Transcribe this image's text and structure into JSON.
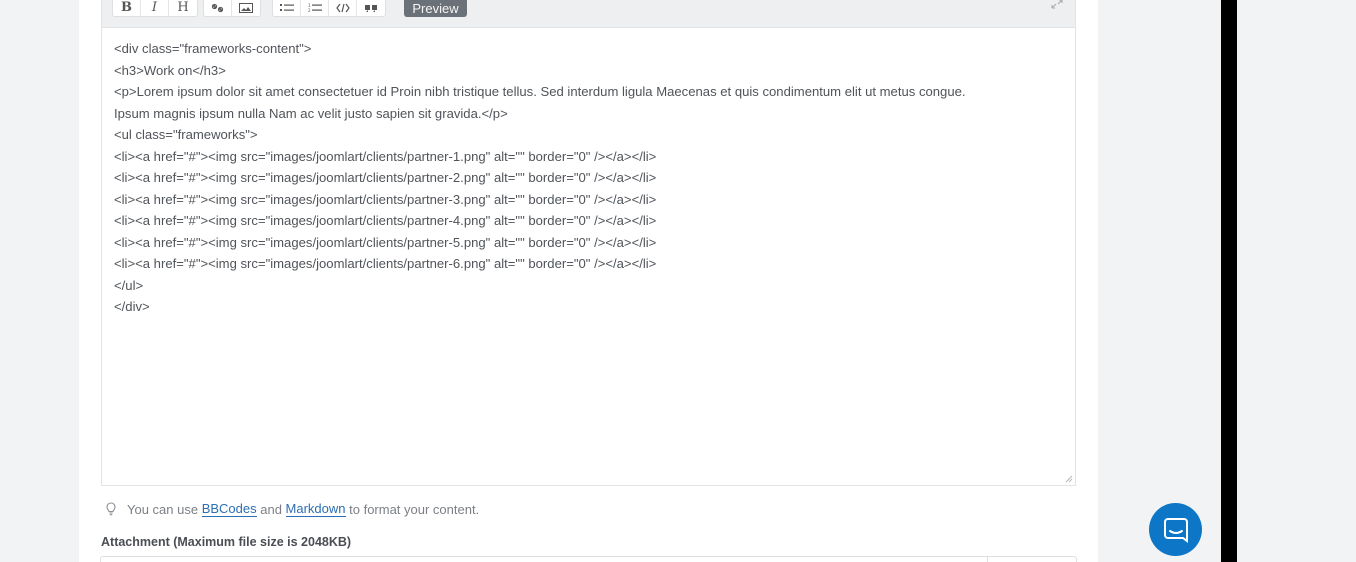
{
  "toolbar": {
    "buttons": [
      {
        "name": "bold",
        "glyph": "B"
      },
      {
        "name": "italic",
        "glyph": "I"
      },
      {
        "name": "heading",
        "glyph": "H"
      }
    ],
    "preview_label": "Preview"
  },
  "editor": {
    "lines": [
      "<div class=\"frameworks-content\">",
      "<h3>Work on</h3>",
      "<p>Lorem ipsum dolor sit amet consectetuer id Proin nibh tristique tellus. Sed interdum ligula Maecenas et quis condimentum elit ut metus congue.",
      "Ipsum magnis ipsum nulla Nam ac velit justo sapien sit gravida.</p>",
      "<ul class=\"frameworks\">",
      "<li><a href=\"#\"><img src=\"images/joomlart/clients/partner-1.png\" alt=\"\" border=\"0\" /></a></li>",
      "<li><a href=\"#\"><img src=\"images/joomlart/clients/partner-2.png\" alt=\"\" border=\"0\" /></a></li>",
      "<li><a href=\"#\"><img src=\"images/joomlart/clients/partner-3.png\" alt=\"\" border=\"0\" /></a></li>",
      "<li><a href=\"#\"><img src=\"images/joomlart/clients/partner-4.png\" alt=\"\" border=\"0\" /></a></li>",
      "<li><a href=\"#\"><img src=\"images/joomlart/clients/partner-5.png\" alt=\"\" border=\"0\" /></a></li>",
      "<li><a href=\"#\"><img src=\"images/joomlart/clients/partner-6.png\" alt=\"\" border=\"0\" /></a></li>",
      "</ul>",
      "</div>"
    ]
  },
  "hint": {
    "prefix": "You can use ",
    "bbcodes_link": "BBCodes",
    "middle": " and ",
    "markdown_link": "Markdown",
    "suffix": " to format your content."
  },
  "attachment": {
    "label": "Attachment (Maximum file size is 2048KB)"
  },
  "icons": {
    "hint": "lightbulb-icon",
    "chat": "chat-bubble-icon",
    "expand": "expand-icon"
  },
  "colors": {
    "preview_button": "#6b7178",
    "link": "#2b6fb3",
    "chat_launcher": "#0e76c6"
  }
}
